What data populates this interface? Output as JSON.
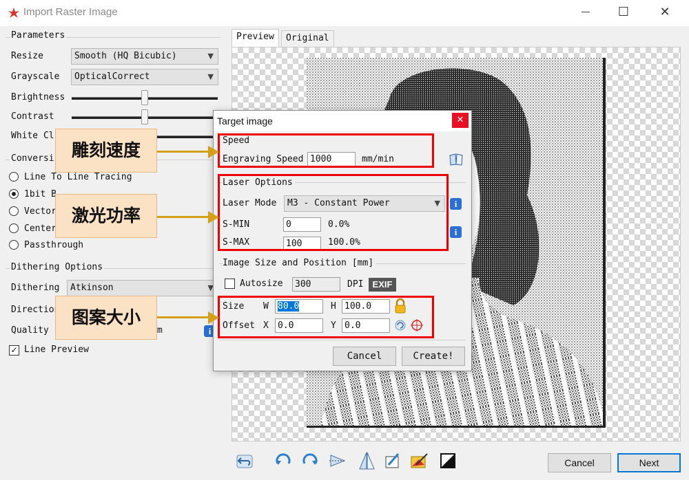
{
  "window": {
    "title": "Import Raster Image",
    "minimize": "—",
    "maximize": "☐",
    "close": "✕"
  },
  "parameters": {
    "title": "Parameters",
    "resize_label": "Resize",
    "resize_value": "Smooth (HQ Bicubic)",
    "grayscale_label": "Grayscale",
    "grayscale_value": "OpticalCorrect",
    "brightness_label": "Brightness",
    "brightness_level": 0.5,
    "contrast_label": "Contrast",
    "contrast_level": 0.5,
    "white_clip_label": "White Cl"
  },
  "conversion": {
    "title": "Conversi",
    "options": [
      "Line To Line Tracing",
      "1bit B",
      "Vector",
      "Center",
      "Passthrough"
    ],
    "selected_index": 1
  },
  "dithering": {
    "title": "Dithering Options",
    "dithering_label": "Dithering",
    "dithering_value": "Atkinson",
    "direction_label": "Direction",
    "quality_label": "Quality",
    "quality_unit": "m",
    "line_preview_label": "Line Preview",
    "line_preview_checked": true
  },
  "preview": {
    "tabs": [
      "Preview",
      "Original"
    ],
    "active_tab": 0
  },
  "dialog": {
    "title": "Target image",
    "speed": {
      "title": "Speed",
      "label": "Engraving Speed",
      "value": "1000",
      "unit": "mm/min"
    },
    "laser": {
      "title": "Laser Options",
      "mode_label": "Laser Mode",
      "mode_value": "M3 - Constant Power",
      "smin_label": "S-MIN",
      "smin_value": "0",
      "smin_pct": "0.0%",
      "smax_label": "S-MAX",
      "smax_value": "100",
      "smax_pct": "100.0%"
    },
    "size": {
      "title": "Image Size and Position [mm]",
      "autosize_label": "Autosize",
      "autosize_checked": false,
      "dpi_value": "300",
      "dpi_label": "DPI",
      "exif_label": "EXIF",
      "size_label": "Size",
      "w_label": "W",
      "w_value": "80.0",
      "h_label": "H",
      "h_value": "100.0",
      "offset_label": "Offset",
      "x_label": "X",
      "x_value": "0.0",
      "y_label": "Y",
      "y_value": "0.0"
    },
    "cancel": "Cancel",
    "create": "Create!",
    "info_glyph": "i",
    "close_glyph": "✕"
  },
  "callouts": [
    "雕刻速度",
    "激光功率",
    "图案大小"
  ],
  "footer": {
    "cancel": "Cancel",
    "next": "Next"
  },
  "toolbar_icons": [
    "undo-icon",
    "rotate-ccw-icon",
    "rotate-cw-icon",
    "flip-horizontal-icon",
    "flip-vertical-icon",
    "crop-icon",
    "auto-trim-icon",
    "invert-icon"
  ],
  "colors": {
    "annotation_red": "#e00000",
    "callout_fill": "#fbe2c4",
    "arrow": "#d4a017",
    "info_blue": "#2a6fd6",
    "default_button_border": "#0078d7"
  }
}
